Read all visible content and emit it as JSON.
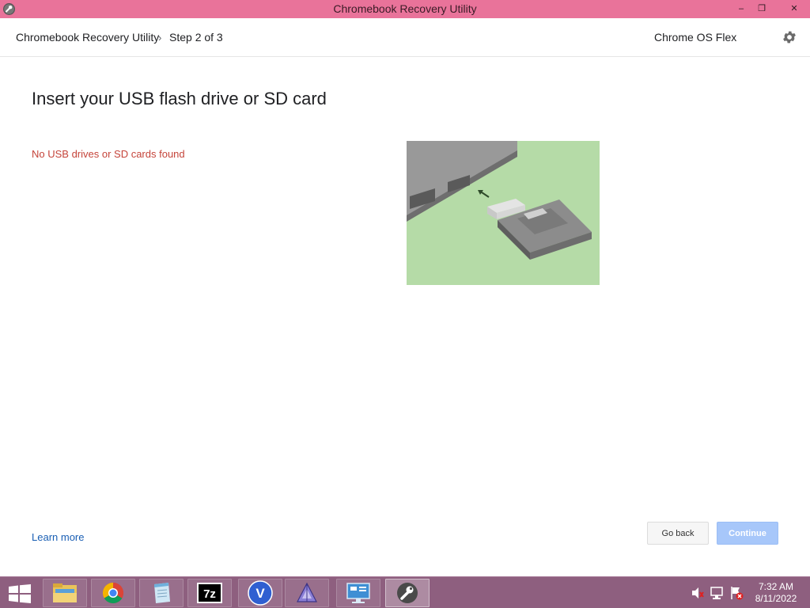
{
  "window": {
    "title": "Chromebook Recovery Utility",
    "controls": {
      "minimize": "–",
      "maximize": "❐",
      "close": "✕"
    }
  },
  "header": {
    "app_name": "Chromebook Recovery Utility",
    "separator": "›",
    "step": "Step 2 of 3",
    "device": "Chrome OS Flex",
    "settings_icon": "gear-icon"
  },
  "main": {
    "heading": "Insert your USB flash drive or SD card",
    "error_message": "No USB drives or SD cards found",
    "illustration": "usb-insert-illustration"
  },
  "footer": {
    "learn_more": "Learn more",
    "go_back": "Go back",
    "continue": "Continue"
  },
  "taskbar": {
    "items": [
      "file-explorer",
      "chrome",
      "notepad",
      "7zip",
      "v-app",
      "app-triangle",
      "remote-desktop",
      "recovery-utility"
    ],
    "tray_icons": [
      "speaker-muted-icon",
      "network-icon",
      "action-center-icon"
    ],
    "time": "7:32 AM",
    "date": "8/11/2022"
  },
  "colors": {
    "titlebar": "#e9739a",
    "taskbar": "#8e5f7f",
    "error": "#c5443a",
    "link": "#1a5fb4",
    "continue_disabled": "#a7c7fa",
    "illustration_bg": "#b5dba7"
  }
}
